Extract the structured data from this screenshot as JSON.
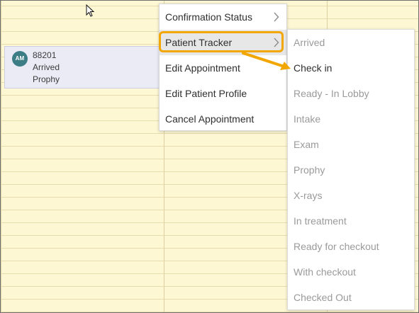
{
  "appointment": {
    "initials": "AM",
    "code": "88201",
    "status": "Arrived",
    "type": "Prophy"
  },
  "context_menu": {
    "items": [
      {
        "label": "Confirmation Status",
        "has_submenu": true
      },
      {
        "label": "Patient Tracker",
        "has_submenu": true,
        "active": true
      },
      {
        "label": "Edit Appointment"
      },
      {
        "label": "Edit Patient Profile"
      },
      {
        "label": "Cancel Appointment"
      }
    ]
  },
  "patient_tracker_submenu": {
    "items": [
      {
        "label": "Arrived",
        "enabled": false
      },
      {
        "label": "Check in",
        "enabled": true
      },
      {
        "label": "Ready - In Lobby",
        "enabled": false
      },
      {
        "label": "Intake",
        "enabled": false
      },
      {
        "label": "Exam",
        "enabled": false
      },
      {
        "label": "Prophy",
        "enabled": false
      },
      {
        "label": "X-rays",
        "enabled": false
      },
      {
        "label": "In treatment",
        "enabled": false
      },
      {
        "label": "Ready for checkout",
        "enabled": false
      },
      {
        "label": "With checkout",
        "enabled": false
      },
      {
        "label": "Checked Out",
        "enabled": false
      }
    ]
  },
  "colors": {
    "calendar_background": "#fdf7d4",
    "appointment_background": "#ebebf6",
    "avatar_background": "#3d7d86",
    "highlight": "#f2a600",
    "menu_active_background": "#e7e7e7",
    "disabled_text": "#9a9a9a"
  },
  "icons": {
    "cursor": "mouse-pointer-icon",
    "submenu_arrow": "chevron-right-icon",
    "annotation": "orange-arrow-annotation"
  }
}
